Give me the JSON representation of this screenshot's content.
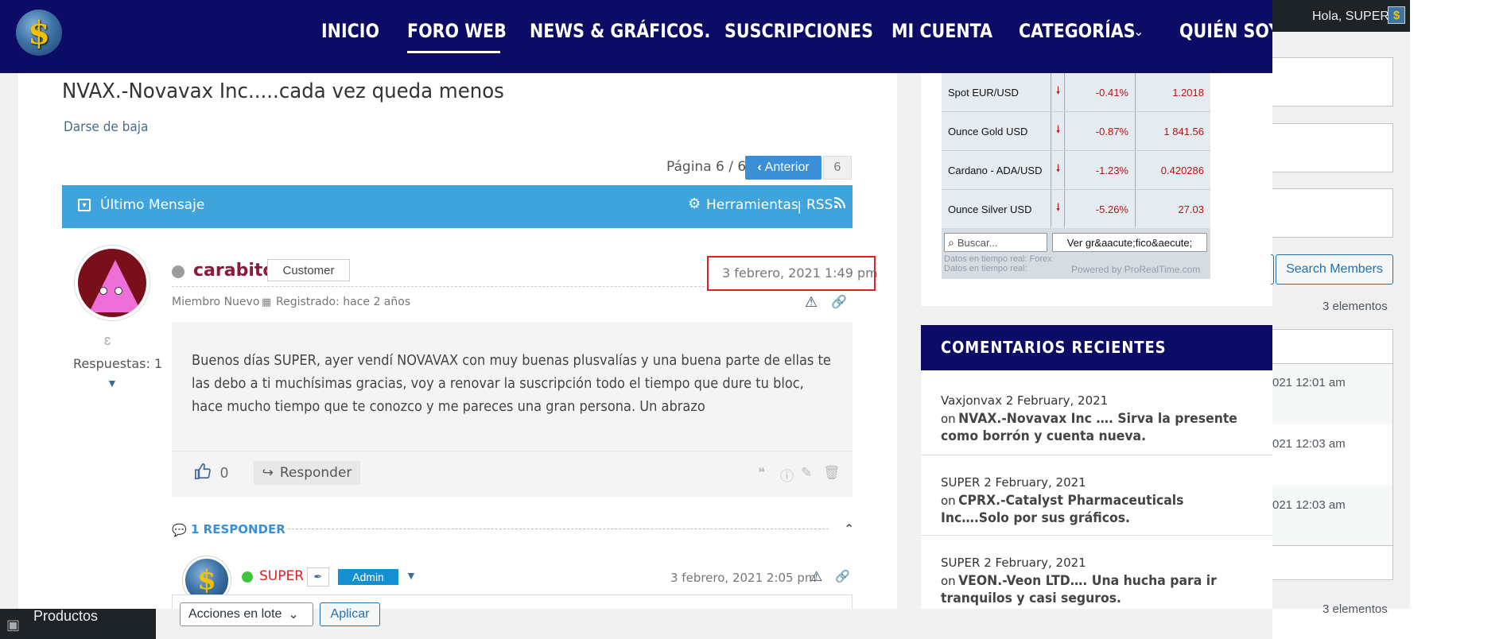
{
  "nav": {
    "logo_glyph": "$",
    "items": [
      {
        "label": "INICIO"
      },
      {
        "label": "FORO WEB"
      },
      {
        "label": "NEWS & GRÁFICOS."
      },
      {
        "label": "SUSCRIPCIONES"
      },
      {
        "label": "MI CUENTA"
      },
      {
        "label": "CATEGORÍAS"
      },
      {
        "label": "QUIÉN SOY"
      }
    ],
    "categories_dropdown_icon": "chevron-down-icon",
    "active_index": 1
  },
  "admin_bar": {
    "greeting": "Hola, SUPER",
    "avatar_glyph": "$"
  },
  "admin_menu": {
    "productos_label": "Productos"
  },
  "topic": {
    "title": "NVAX.-Novavax Inc.....cada vez queda menos",
    "unsubscribe": "Darse de baja",
    "page_info": "Página 6 / 6",
    "prev_label": "Anterior",
    "current_page": "6",
    "bar": {
      "last_message": "Último Mensaje",
      "tools": "Herramientas",
      "divider": "|",
      "rss": "RSS"
    }
  },
  "post": {
    "author": "carabito",
    "badge": "Customer",
    "date": "3 febrero, 2021 1:49 pm",
    "role": "Miembro Nuevo",
    "registered": "Registrado: hace 2 años",
    "replies": "Respuestas: 1",
    "body_lines": [
      "Buenos días SUPER, ayer vendí NOVAVAX con muy buenas plusvalías y una buena parte de ellas te",
      "las debo a ti muchísimas gracias, voy a renovar la suscripción todo el tiempo que dure tu bloc,",
      "hace mucho tiempo que te conozco y me pareces una gran persona. Un abrazo"
    ],
    "likes": "0",
    "reply_label": "Responder",
    "replies_toggle": "1 RESPONDER"
  },
  "reply": {
    "avatar_glyph": "$",
    "author": "SUPER",
    "badge": "Admin",
    "date": "3 febrero, 2021 2:05 pm"
  },
  "bulk": {
    "select_value": "Acciones en lote",
    "apply": "Aplicar"
  },
  "quotes": {
    "rows": [
      {
        "name": "Spot EUR/USD",
        "change": "-0.41%",
        "value": "1.2018"
      },
      {
        "name": "Ounce Gold USD",
        "change": "-0.87%",
        "value": "1 841.56"
      },
      {
        "name": "Cardano - ADA/USD",
        "change": "-1.23%",
        "value": "0.420286"
      },
      {
        "name": "Ounce Silver USD",
        "change": "-5.26%",
        "value": "27.03"
      }
    ],
    "search_placeholder": "Buscar...",
    "chart_button": "Ver gr&aacute;fico&aecute;",
    "realtime_1": "Datos en tiempo real: Forex",
    "realtime_2": "Datos en tiempo real:",
    "powered_by": "Powered by ProRealTime.com",
    "down_color": "#c01010"
  },
  "recent_comments": {
    "title": "COMENTARIOS RECIENTES",
    "on_word": "on",
    "items": [
      {
        "meta": "Vaxjonvax 2 February, 2021",
        "link": "NVAX.-Novavax Inc …. Sirva la presente como borrón y cuenta nueva."
      },
      {
        "meta": "SUPER 2 February, 2021",
        "link": "CPRX.-Catalyst Pharmaceuticals Inc….Solo por sus gráficos."
      },
      {
        "meta": "SUPER 2 February, 2021",
        "link": "VEON.-Veon LTD…. Una hucha para ir tranquilos y casi seguros."
      }
    ]
  },
  "right_panel": {
    "search_members": "Search Members",
    "count_top": "3 elementos",
    "count_bottom": "3 elementos",
    "times": [
      "021 12:01 am",
      "021 12:03 am",
      "021 12:03 am"
    ]
  },
  "colors": {
    "nav_bg": "#0c0b66",
    "topic_bar": "#3fa4dc",
    "author_name": "#8a1a3a",
    "admin_badge": "#1490d2",
    "highlight_box": "#e02020"
  }
}
